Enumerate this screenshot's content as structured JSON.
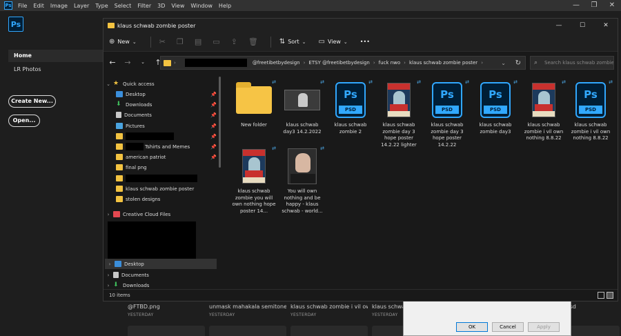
{
  "ps": {
    "logo": "Ps",
    "menu": [
      "File",
      "Edit",
      "Image",
      "Layer",
      "Type",
      "Select",
      "Filter",
      "3D",
      "View",
      "Window",
      "Help"
    ],
    "nav": {
      "home": "Home",
      "lr_photos": "LR Photos"
    },
    "buttons": {
      "create_new": "Create New...",
      "open": "Open..."
    },
    "recent": [
      {
        "name": "@FTBD.png",
        "date": "YESTERDAY"
      },
      {
        "name": "unmask mahakala semitone s...",
        "date": "YESTERDAY"
      },
      {
        "name": "klaus schwab zombie i vil own...",
        "date": "YESTERDAY"
      },
      {
        "name": "klaus schwab",
        "date": "YESTERDAY"
      },
      {
        "name": ".psd",
        "date": ""
      }
    ]
  },
  "dialog": {
    "ok": "OK",
    "cancel": "Cancel",
    "apply": "Apply"
  },
  "explorer": {
    "title": "klaus schwab zombie poster",
    "toolbar": {
      "new": "New",
      "sort": "Sort",
      "view": "View",
      "more": "•••"
    },
    "breadcrumbs": [
      "@freetibetbydesign",
      "ETSY @freetibetbydesign",
      "fuck nwo",
      "klaus schwab zombie poster"
    ],
    "search_placeholder": "Search klaus schwab zombie ...",
    "nav": {
      "quick_access": "Quick access",
      "desktop": "Desktop",
      "downloads": "Downloads",
      "documents": "Documents",
      "pictures": "Pictures",
      "tshirts": "Tshirts and Memes",
      "american_patriot": "american patriot",
      "final_png": "final png",
      "poster_folder": "klaus schwab zombie poster",
      "stolen_designs": "stolen designs",
      "creative_cloud": "Creative Cloud Files",
      "desktop2": "Desktop",
      "documents2": "Documents",
      "downloads2": "Downloads"
    },
    "files": [
      {
        "name": "New folder",
        "kind": "folder"
      },
      {
        "name": "klaus schwab day3 14.2.2022",
        "kind": "screenshot"
      },
      {
        "name": "klaus schwab zombie 2",
        "kind": "psd"
      },
      {
        "name": "klaus schwab zombie day 3 hope poster 14.2.22 lighter",
        "kind": "poster"
      },
      {
        "name": "klaus schwab zombie day 3 hope poster 14.2.22",
        "kind": "psd"
      },
      {
        "name": "klaus schwab zombie day3",
        "kind": "psd"
      },
      {
        "name": "klaus schwab zombie i vil own nothing 8.8.22",
        "kind": "poster"
      },
      {
        "name": "klaus schwab zombie i vil own nothing 8.8.22",
        "kind": "psd"
      },
      {
        "name": "klaus schwab zombie you will own nothing hope poster 14...",
        "kind": "poster"
      },
      {
        "name": "You will own nothing and be happy - klaus schwab - world...",
        "kind": "photo"
      }
    ],
    "status": "10 items"
  }
}
